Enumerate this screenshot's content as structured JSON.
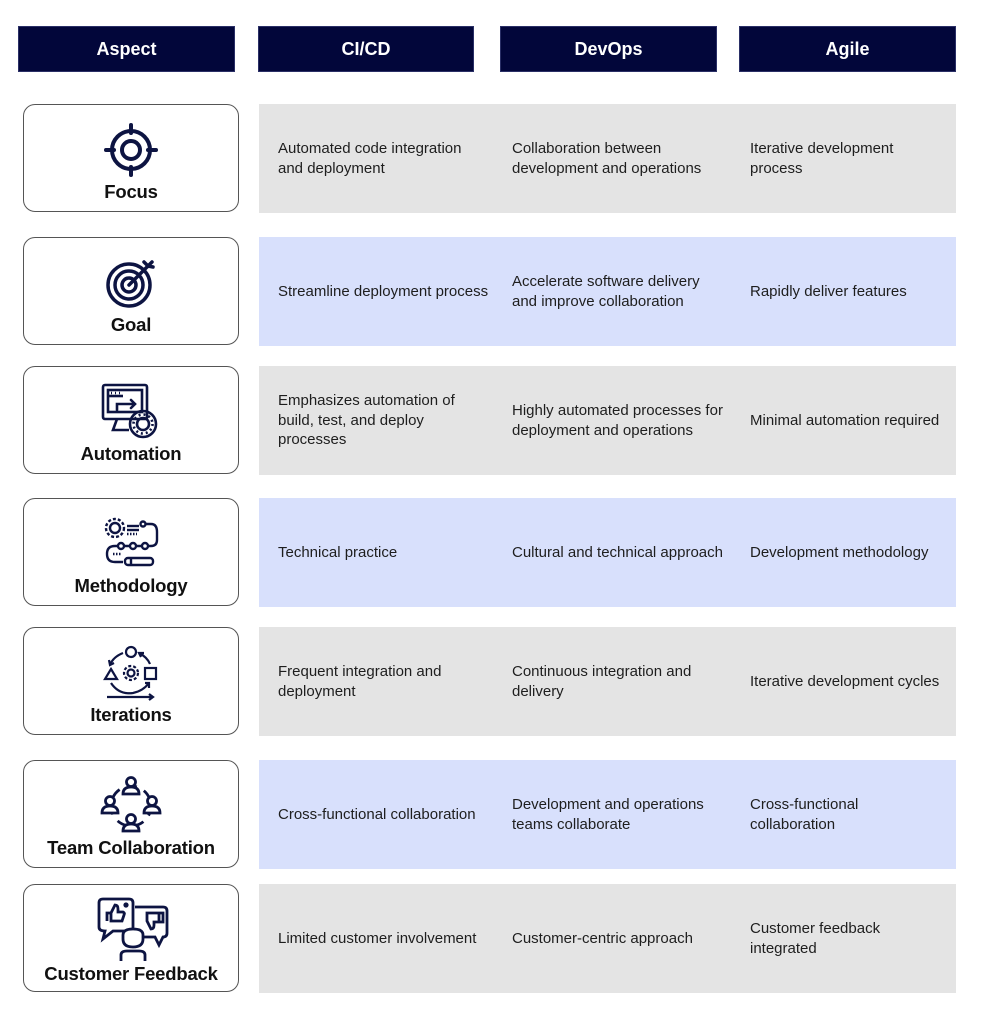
{
  "headers": {
    "aspect": "Aspect",
    "cicd": "CI/CD",
    "devops": "DevOps",
    "agile": "Agile"
  },
  "colors": {
    "header_bg": "#02063a",
    "row_gray": "#e4e4e4",
    "row_blue": "#d8e0fc",
    "icon": "#0d1442"
  },
  "rows": [
    {
      "aspect": "Focus",
      "icon": "crosshair-target-icon",
      "cicd": "Automated code integration and deployment",
      "devops": "Collaboration between development and operations",
      "agile": "Iterative development process"
    },
    {
      "aspect": "Goal",
      "icon": "bullseye-dart-icon",
      "cicd": "Streamline deployment process",
      "devops": "Accelerate software delivery and improve collaboration",
      "agile": "Rapidly deliver features"
    },
    {
      "aspect": "Automation",
      "icon": "monitor-gear-icon",
      "cicd": "Emphasizes automation of build, test, and deploy processes",
      "devops": "Highly automated processes for deployment and operations",
      "agile": "Minimal automation required"
    },
    {
      "aspect": "Methodology",
      "icon": "gear-process-pencil-icon",
      "cicd": "Technical practice",
      "devops": "Cultural and technical approach",
      "agile": "Development methodology"
    },
    {
      "aspect": "Iterations",
      "icon": "cycle-shapes-gear-icon",
      "cicd": "Frequent integration and deployment",
      "devops": "Continuous integration and delivery",
      "agile": "Iterative development cycles"
    },
    {
      "aspect": "Team Collaboration",
      "icon": "team-circle-icon",
      "cicd": "Cross-functional collaboration",
      "devops": "Development and operations teams collaborate",
      "agile": "Cross-functional collaboration"
    },
    {
      "aspect": "Customer Feedback",
      "icon": "customer-feedback-thumbs-icon",
      "cicd": "Limited customer involvement",
      "devops": "Customer-centric approach",
      "agile": "Customer feedback integrated"
    }
  ]
}
